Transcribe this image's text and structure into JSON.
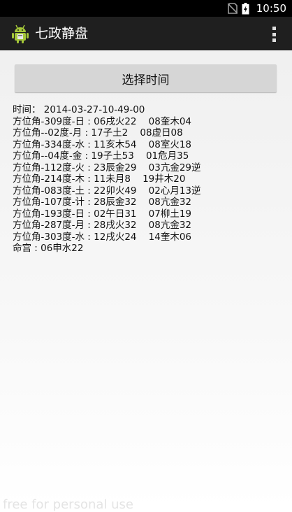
{
  "status_bar": {
    "time": "10:50",
    "icons": [
      "no-sim-icon",
      "battery-charging-icon"
    ]
  },
  "action_bar": {
    "title": "七政静盘",
    "icon": "android-app-icon",
    "menu_icon": "overflow-menu-icon"
  },
  "main": {
    "select_time_button": "选择时间",
    "time_label": "时间：",
    "time_value": "2014-03-27-10-49-00",
    "lines": [
      "方位角-309度-日 : 06戌火22    08奎木04",
      "方位角--02度-月 : 17子土2    08虚日08",
      "方位角-334度-水 : 11亥木54    08室火18",
      "方位角--04度-金 : 19子土53    01危月35",
      "方位角-112度-火 : 23辰金29    03亢金29逆",
      "方位角-214度-木 : 11未月8    19井木20",
      "方位角-083度-土 : 22卯火49    02心月13逆",
      "方位角-107度-计 : 28辰金32    08亢金32",
      "方位角-193度-日 : 02午日31    07柳土19",
      "方位角-287度-月 : 28戌火32    08亢金32",
      "方位角-303度-水 : 12戌火24    14奎木06",
      "命宫 : 06申水22"
    ]
  },
  "watermark": "free for personal use"
}
